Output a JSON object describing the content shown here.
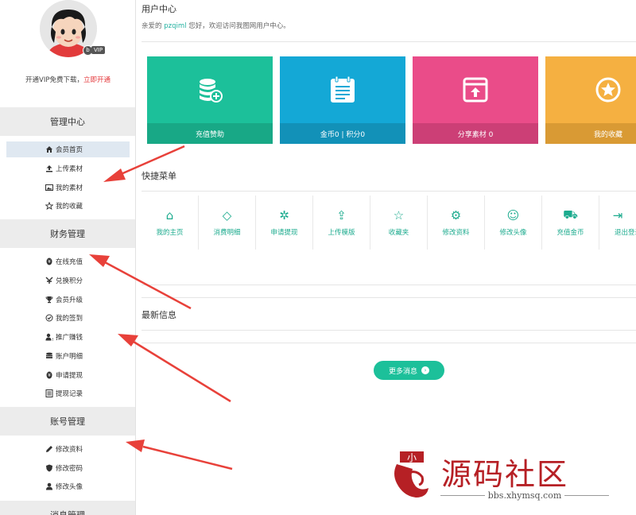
{
  "sidebar": {
    "vip_text": "开通VIP免费下载，",
    "vip_link": "立即开通",
    "badge_b": "b",
    "badge_vip": "VIP",
    "sections": {
      "manage": "管理中心",
      "finance": "财务管理",
      "account": "账号管理",
      "message": "消息管理"
    },
    "manage_items": [
      {
        "label": "会员首页",
        "icon": "home-icon"
      },
      {
        "label": "上传素材",
        "icon": "upload-icon"
      },
      {
        "label": "我的素材",
        "icon": "image-icon"
      },
      {
        "label": "我的收藏",
        "icon": "star-icon"
      }
    ],
    "finance_items": [
      {
        "label": "在线充值",
        "icon": "coin-icon"
      },
      {
        "label": "兑换积分",
        "icon": "exchange-icon"
      },
      {
        "label": "会员升级",
        "icon": "trophy-icon"
      },
      {
        "label": "我的签到",
        "icon": "check-circle-icon"
      },
      {
        "label": "推广赚钱",
        "icon": "user-icon"
      },
      {
        "label": "账户明细",
        "icon": "database-icon"
      },
      {
        "label": "申请提现",
        "icon": "coin-icon"
      },
      {
        "label": "提现记录",
        "icon": "list-icon"
      }
    ],
    "account_items": [
      {
        "label": "修改资料",
        "icon": "pencil-icon"
      },
      {
        "label": "修改密码",
        "icon": "shield-icon"
      },
      {
        "label": "修改头像",
        "icon": "user-icon"
      }
    ]
  },
  "main": {
    "title": "用户中心",
    "greet_prefix": "亲爱的",
    "username": "pzqiml",
    "greet_suffix": "您好，欢迎访问我图网用户中心。",
    "cards": [
      {
        "label": "充值赞助",
        "color": "#1cc09a",
        "icon": "coins-plus-icon"
      },
      {
        "label": "金币0 | 积分0",
        "color": "#14a8d6",
        "icon": "ledger-icon"
      },
      {
        "label": "分享素材 0",
        "color": "#ea4c89",
        "icon": "share-window-icon"
      },
      {
        "label": "我的收藏",
        "color": "#f5b041",
        "icon": "star-circle-icon"
      }
    ],
    "quick_title": "快捷菜单",
    "quick_items": [
      {
        "label": "我的主页",
        "icon": "home-icon",
        "glyph": "⌂"
      },
      {
        "label": "消费明细",
        "icon": "diamond-icon",
        "glyph": "◇"
      },
      {
        "label": "申请提现",
        "icon": "bug-icon",
        "glyph": "✲"
      },
      {
        "label": "上传模版",
        "icon": "upload-icon",
        "glyph": "⇪"
      },
      {
        "label": "收藏夹",
        "icon": "star-icon",
        "glyph": "☆"
      },
      {
        "label": "修改资料",
        "icon": "gear-icon",
        "glyph": "⚙"
      },
      {
        "label": "修改头像",
        "icon": "avatar-icon",
        "glyph": "☺"
      },
      {
        "label": "充值金币",
        "icon": "cart-icon",
        "glyph": "⛟"
      },
      {
        "label": "退出登录",
        "icon": "logout-icon",
        "glyph": "⇥"
      }
    ],
    "news_title": "最新信息",
    "more_button": "更多消息",
    "more_arrow": "›"
  },
  "watermark": {
    "title": "源码社区",
    "url": "bbs.xhymsq.com",
    "seal_text": "小"
  },
  "colors": {
    "accent": "#1cc09a",
    "arrow": "#e8413a"
  }
}
